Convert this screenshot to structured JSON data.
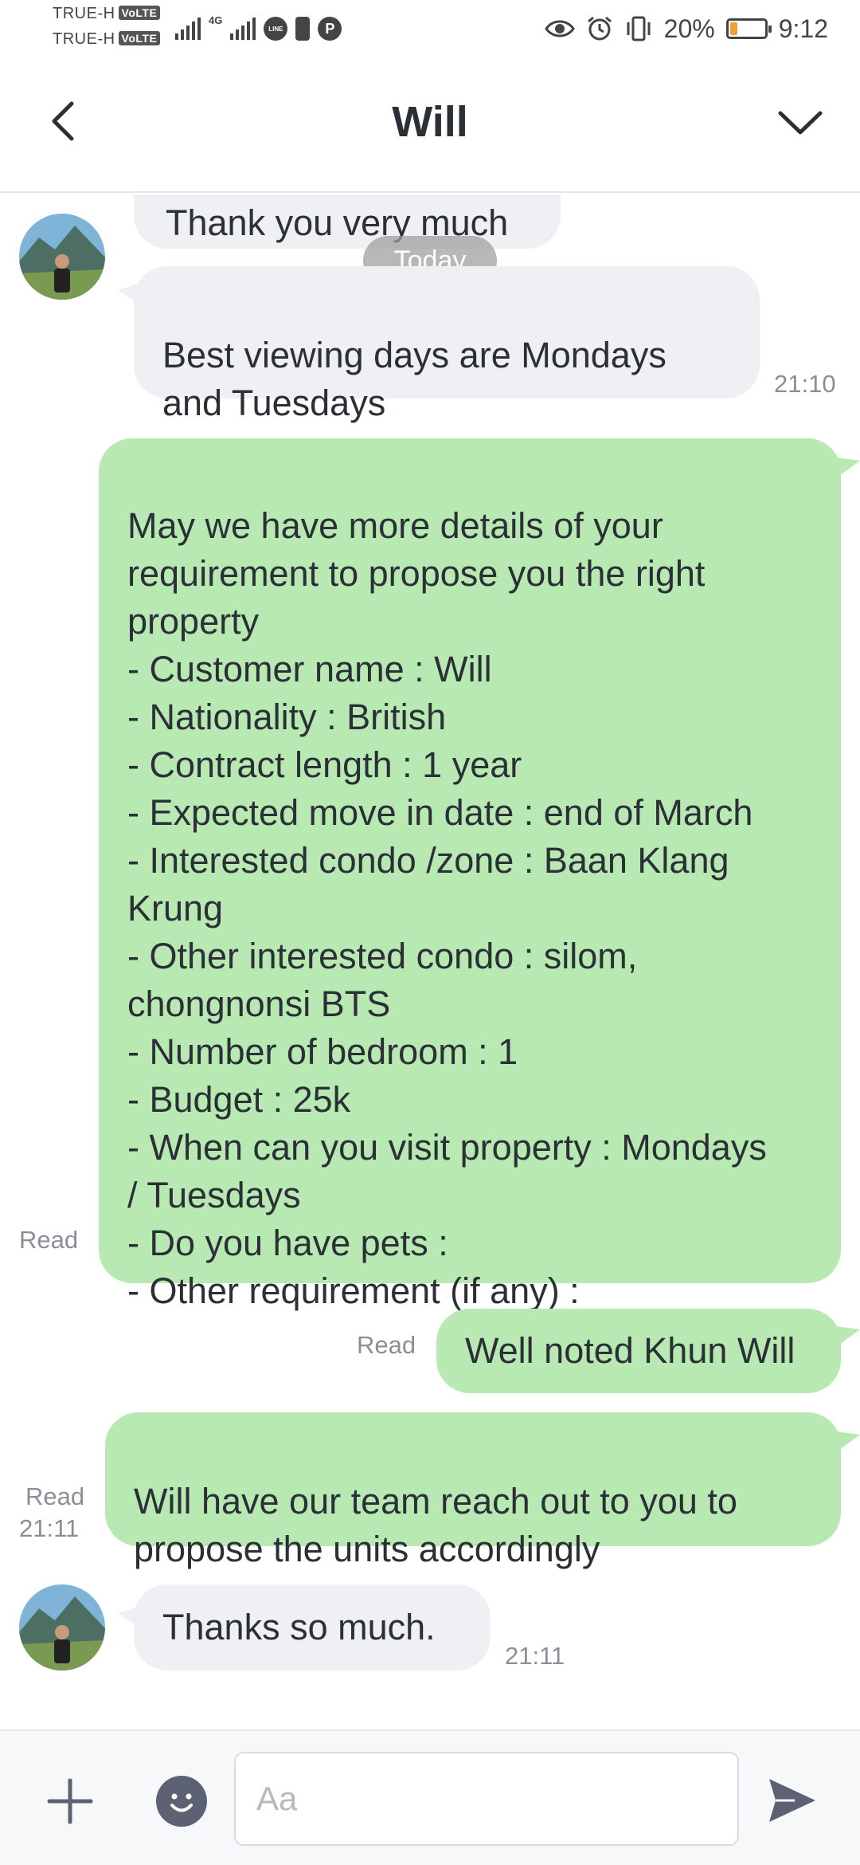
{
  "status_bar": {
    "carrier_1": "TRUE-H",
    "carrier_2": "TRUE-H",
    "volte": "VoLTE",
    "network": "4G",
    "line_badge": "LINE",
    "battery_percent": "20%",
    "battery_level": 0.2,
    "time": "9:12"
  },
  "header": {
    "title": "Will"
  },
  "chat": {
    "date_separator": "Today",
    "messages": [
      {
        "text": "Thank you very much"
      },
      {
        "text": "Best viewing days are Mondays\nand Tuesdays",
        "time": "21:10"
      },
      {
        "text": "May we have more details of your\nrequirement to propose you the right\nproperty\n- Customer name : Will\n- Nationality : British\n- Contract length : 1 year\n- Expected move in date : end of March\n- Interested condo /zone : Baan Klang\nKrung\n- Other interested condo : silom,\nchongnonsi BTS\n- Number of bedroom  : 1\n- Budget : 25k\n- When can you visit property : Mondays\n/ Tuesdays\n- Do you have pets :\n- Other requirement (if any) :",
        "status": "Read"
      },
      {
        "text": "Well noted Khun Will",
        "status": "Read"
      },
      {
        "text": "Will have our team reach out to you to\npropose the units accordingly",
        "status": "Read",
        "time": "21:11"
      },
      {
        "text": "Thanks so much.",
        "time": "21:11"
      }
    ]
  },
  "input_bar": {
    "placeholder": "Aa",
    "value": ""
  },
  "colors": {
    "outgoing_bubble": "#b9e9b3",
    "incoming_bubble": "#eff0f3",
    "icon_dark": "#5c6273"
  }
}
